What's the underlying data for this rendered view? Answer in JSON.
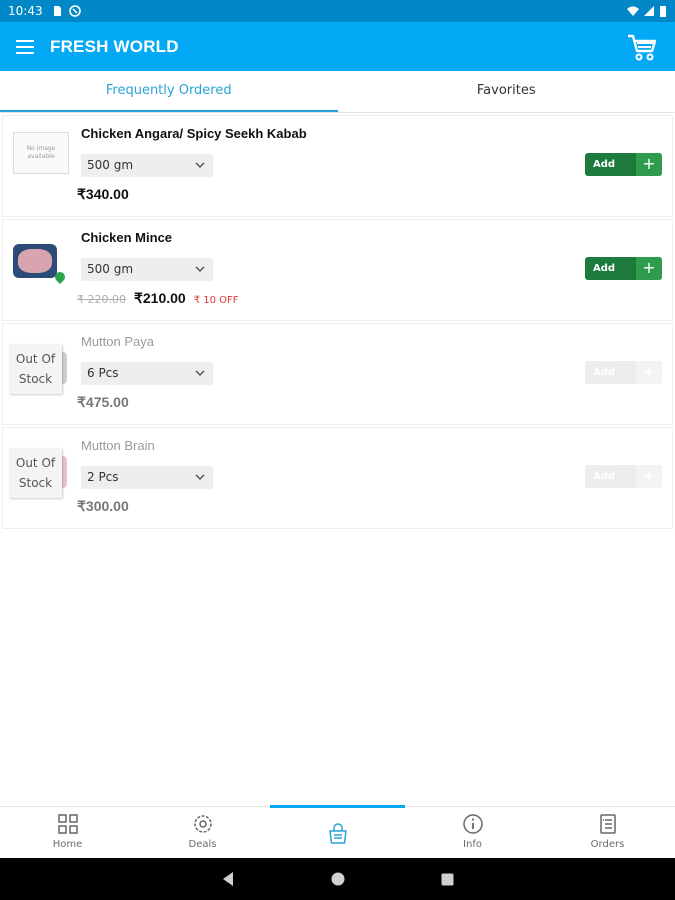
{
  "status_bar": {
    "time": "10:43"
  },
  "app": {
    "title": "FRESH WORLD"
  },
  "tabs": [
    {
      "label": "Frequently Ordered",
      "active": true
    },
    {
      "label": "Favorites",
      "active": false
    }
  ],
  "no_image_text": "No image available",
  "out_of_stock_label": {
    "line1": "Out Of",
    "line2": "Stock"
  },
  "products": [
    {
      "name": "Chicken Angara/ Spicy Seekh Kabab",
      "variant": "500 gm",
      "price": "₹340.00",
      "add_label": "Add"
    },
    {
      "name": "Chicken Mince",
      "variant": "500 gm",
      "mrp": "₹ 220.00",
      "price": "₹210.00",
      "discount": "₹ 10 OFF",
      "add_label": "Add"
    },
    {
      "name": "Mutton Paya",
      "variant": "6 Pcs",
      "price": "₹475.00",
      "add_label": "Add",
      "out_of_stock": true
    },
    {
      "name": "Mutton Brain",
      "variant": "2 Pcs",
      "price": "₹300.00",
      "add_label": "Add",
      "out_of_stock": true
    }
  ],
  "bottom_nav": [
    {
      "label": "Home",
      "icon": "grid-icon"
    },
    {
      "label": "Deals",
      "icon": "gear-badge-icon"
    },
    {
      "label": "",
      "icon": "shopping-bag-icon",
      "active": true
    },
    {
      "label": "Info",
      "icon": "info-icon"
    },
    {
      "label": "Orders",
      "icon": "orders-list-icon"
    }
  ],
  "colors": {
    "primary": "#03a9f4",
    "status_bar": "#0288c7",
    "add_button": "#1c7a3c",
    "discount": "#e53935",
    "tab_active": "#29a3d6"
  }
}
